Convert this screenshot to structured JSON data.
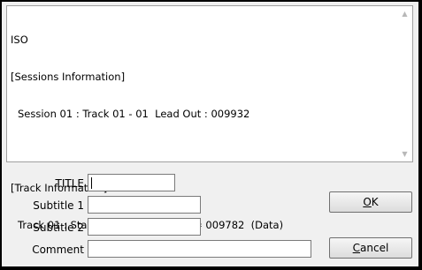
{
  "info_panel": {
    "lines": [
      "ISO",
      "[Sessions Information]",
      "Session 01 : Track 01 - 01  Lead Out : 009932",
      "",
      "[Track Information]",
      "Track 01 : Start = 000000  Length = 009782  (Data)"
    ]
  },
  "form": {
    "title_label": "TITLE",
    "title_value": "",
    "subtitle1_label": "Subtitle 1",
    "subtitle1_value": "",
    "subtitle2_label": "Subtitle 2",
    "subtitle2_value": "",
    "comment_label": "Comment",
    "comment_value": ""
  },
  "buttons": {
    "ok_accel": "O",
    "ok_rest": "K",
    "cancel_accel": "C",
    "cancel_rest": "ancel"
  },
  "icons": {
    "scroll_up": "scroll-up-arrow",
    "scroll_down": "scroll-down-arrow"
  },
  "colors": {
    "dialog_bg": "#f0f0f0",
    "frame": "#000000",
    "text_bg": "#ffffff"
  }
}
